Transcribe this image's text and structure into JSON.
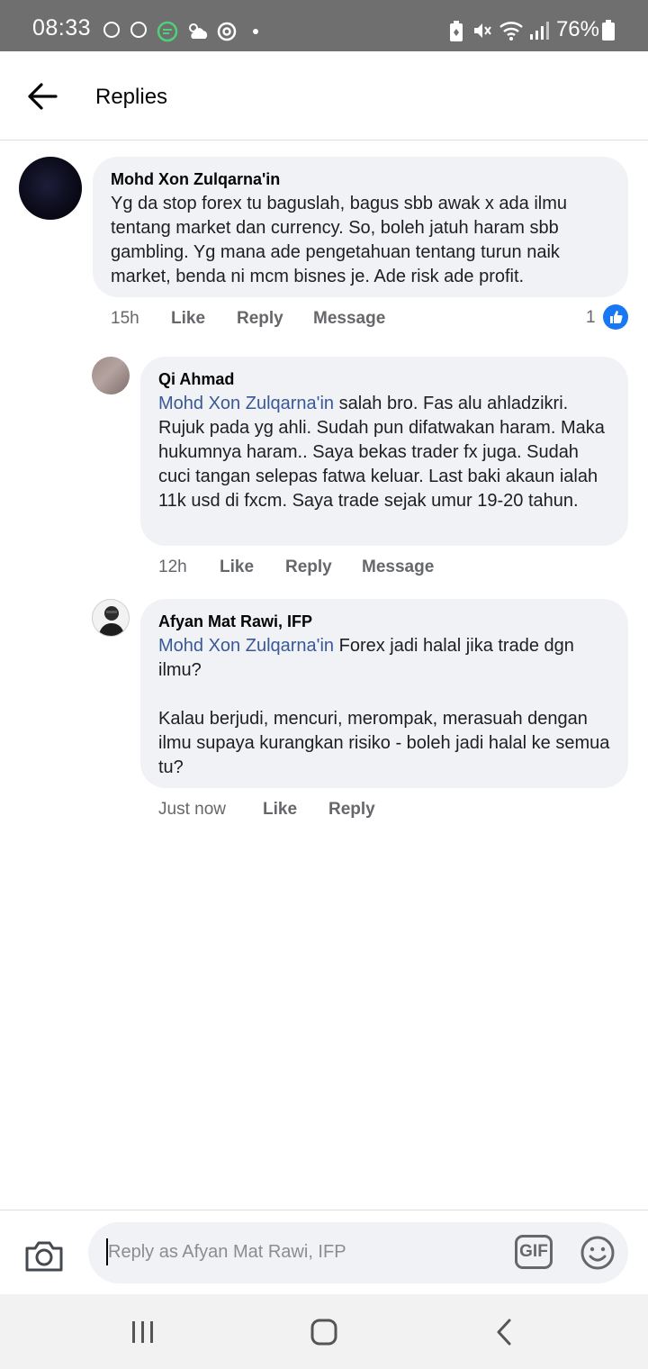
{
  "status_bar": {
    "time": "08:33",
    "battery": "76%",
    "icons": [
      "circle-icon",
      "circle-icon",
      "message-icon",
      "cloud-sun-icon",
      "target-icon",
      "dot-icon",
      "battery-saver-icon",
      "mute-icon",
      "wifi-icon",
      "signal-icon",
      "battery-icon"
    ]
  },
  "header": {
    "title": "Replies",
    "back_icon": "back-arrow-icon"
  },
  "comments": [
    {
      "author": "Mohd Xon Zulqarna'in",
      "text": "Yg da stop forex tu baguslah, bagus sbb awak x ada ilmu tentang market dan currency. So, boleh jatuh haram sbb gambling. Yg mana ade pengetahuan tentang turun naik market, benda ni mcm bisnes je. Ade risk ade profit.",
      "time": "15h",
      "like_label": "Like",
      "reply_label": "Reply",
      "message_label": "Message",
      "reaction_count": "1"
    },
    {
      "author": "Qi Ahmad",
      "mention": "Mohd Xon Zulqarna'in",
      "text": " salah bro. Fas alu ahladzikri. Rujuk pada yg ahli. Sudah pun difatwakan haram. Maka hukumnya haram.. Saya bekas trader fx juga. Sudah cuci tangan selepas fatwa keluar. Last baki akaun ialah 11k usd di fxcm. Saya trade sejak umur 19-20 tahun.",
      "time": "12h",
      "like_label": "Like",
      "reply_label": "Reply",
      "message_label": "Message"
    },
    {
      "author": "Afyan Mat Rawi, IFP",
      "mention": "Mohd Xon Zulqarna'in",
      "text_line1": " Forex jadi halal jika trade dgn ilmu?",
      "text_para2": "Kalau berjudi, mencuri, merompak, merasuah dengan ilmu supaya kurangkan risiko - boleh jadi halal ke semua tu?",
      "time": "Just now",
      "like_label": "Like",
      "reply_label": "Reply"
    }
  ],
  "composer": {
    "placeholder": "Reply as Afyan Mat Rawi, IFP",
    "gif_label": "GIF"
  },
  "colors": {
    "bubble": "#f0f2f5",
    "mention": "#385898",
    "like_blue": "#1877f2",
    "status_bar": "#6f6f6f"
  }
}
